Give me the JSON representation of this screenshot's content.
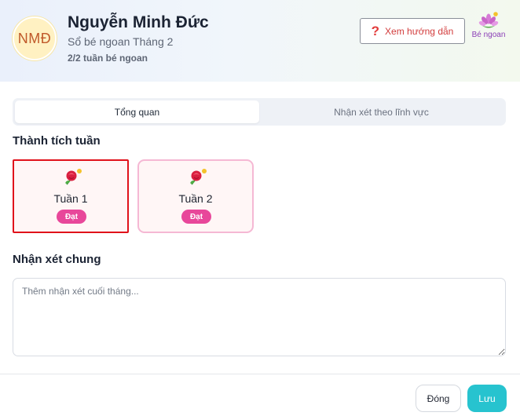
{
  "header": {
    "avatar_initials": "NMĐ",
    "student_name": "Nguyễn Minh Đức",
    "subtitle": "Sổ bé ngoan Tháng 2",
    "progress": "2/2 tuần bé ngoan",
    "guide_button": {
      "label": "Xem hướng dẫn",
      "icon": "question-icon"
    },
    "badge": {
      "label": "Bé ngoan",
      "icon": "flower-icon"
    }
  },
  "tabs": [
    {
      "label": "Tổng quan",
      "active": true
    },
    {
      "label": "Nhận xét theo lĩnh vực",
      "active": false
    }
  ],
  "achievements": {
    "title": "Thành tích tuần",
    "weeks": [
      {
        "label": "Tuần 1",
        "status": "Đạt",
        "icon": "rose-icon",
        "selected": true
      },
      {
        "label": "Tuần 2",
        "status": "Đạt",
        "icon": "rose-icon",
        "selected": false
      }
    ]
  },
  "general_comment": {
    "title": "Nhận xét chung",
    "placeholder": "Thêm nhận xét cuối tháng...",
    "value": ""
  },
  "footer": {
    "close_label": "Đóng",
    "save_label": "Lưu"
  },
  "colors": {
    "accent_pink": "#e8479a",
    "save_teal": "#27c3cf",
    "selected_outline": "#e0121b",
    "guide_text": "#d23c3c",
    "badge_text": "#8b3fb6"
  }
}
